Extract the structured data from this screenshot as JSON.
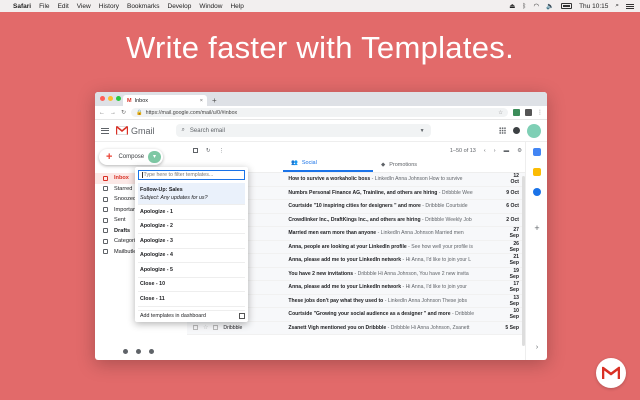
{
  "menubar": {
    "app": "Safari",
    "items": [
      "File",
      "Edit",
      "View",
      "History",
      "Bookmarks",
      "Develop",
      "Window",
      "Help"
    ],
    "clock": "Thu 10:15"
  },
  "hero": {
    "title": "Write faster with Templates."
  },
  "browser": {
    "tab_title": "Inbox",
    "url": "https://mail.google.com/mail/u/0/#inbox"
  },
  "gmail": {
    "logo_text": "Gmail",
    "search_placeholder": "Search email",
    "compose_label": "Compose",
    "nav": [
      {
        "label": "Inbox",
        "active": true
      },
      {
        "label": "Starred"
      },
      {
        "label": "Snoozed"
      },
      {
        "label": "Important"
      },
      {
        "label": "Sent"
      },
      {
        "label": "Drafts"
      },
      {
        "label": "Categories"
      },
      {
        "label": "Mailbutler"
      }
    ],
    "count": "1–50 of 13",
    "tabs": {
      "social": "Social",
      "promotions": "Promotions"
    },
    "rows": [
      {
        "from": "dn",
        "subject": "How to survive a workaholic boss",
        "preview": " - LinkedIn Anna Johnson How to survive",
        "date": "12 Oct"
      },
      {
        "from": "",
        "subject": "Numbrs Personal Finance AG, Trainline, and others are hiring",
        "preview": " - Dribbble Wee",
        "date": "9 Oct"
      },
      {
        "from": "dn",
        "subject": "Courtside \"10 inspiring cities for designers \" and more",
        "preview": " - Dribbble Courtside",
        "date": "6 Oct"
      },
      {
        "from": "dn",
        "subject": "Crowdlinker Inc., DraftKings Inc., and others are hiring",
        "preview": " - Dribbble Weekly Job",
        "date": "2 Oct"
      },
      {
        "from": "dn",
        "subject": "Married men earn more than anyone",
        "preview": " - LinkedIn Anna Johnson Married men",
        "date": "27 Sep"
      },
      {
        "from": "",
        "subject": "Anna, people are looking at your LinkedIn profile",
        "preview": " - See how well your profile is",
        "date": "26 Sep"
      },
      {
        "from": "Lakov",
        "subject": "Anna, please add me to your LinkedIn network",
        "preview": " - Hi Anna, I'd like to join your L",
        "date": "21 Sep"
      },
      {
        "from": "",
        "subject": "You have 2 new invitations",
        "preview": " - Dribbble Hi Anna Johnson, You have 2 new invita",
        "date": "19 Sep"
      },
      {
        "from": "Kohlet",
        "subject": "Anna, please add me to your LinkedIn network",
        "preview": " - Hi Anna, I'd like to join your",
        "date": "17 Sep"
      },
      {
        "from": "dn",
        "subject": "These jobs don't pay what they used to",
        "preview": " - LinkedIn Anna Johnson These jobs",
        "date": "13 Sep"
      },
      {
        "from": "Dribbble",
        "subject": "Courtside \"Growing your social audience as a designer \" and more",
        "preview": " - Dribbble",
        "date": "10 Sep"
      },
      {
        "from": "Dribbble",
        "subject": "Zsanett Vigh mentioned you on Dribbble",
        "preview": " - Dribbble Hi Anna Johnson, Zsanett",
        "date": "5 Sep"
      }
    ]
  },
  "templates": {
    "filter_placeholder": "Type here to filter templates...",
    "first": {
      "title": "Follow-Up: Sales",
      "subject": "Subject: Any updates for us?"
    },
    "items": [
      "Apologize - 1",
      "Apologize - 2",
      "Apologize - 3",
      "Apologize - 4",
      "Apologize - 5",
      "Close - 10",
      "Close - 11"
    ],
    "footer": "Add templates in dashboard"
  },
  "colors": {
    "background": "#e26a6a",
    "gmail_red": "#d93025",
    "accent_green": "#7ec8a4",
    "link_blue": "#1a73e8"
  }
}
